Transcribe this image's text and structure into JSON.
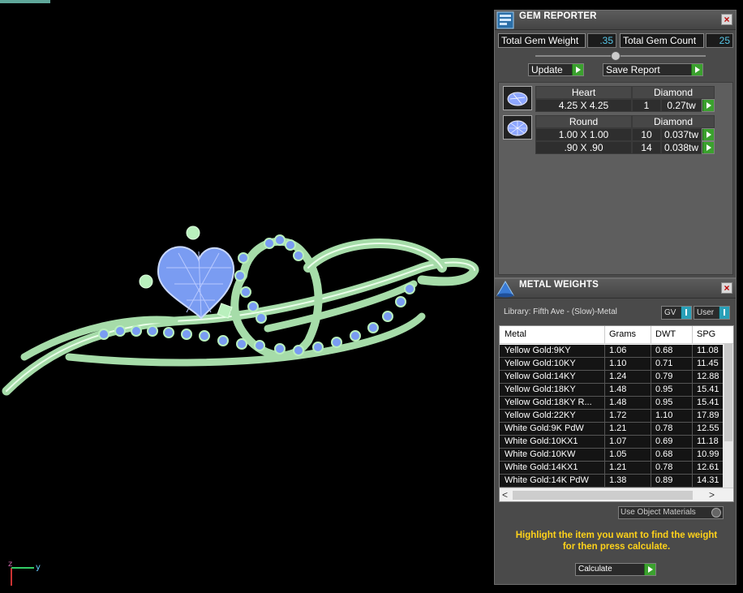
{
  "viewport": {
    "axis": {
      "z": "z",
      "y": "y"
    },
    "colors": {
      "metal": "#b9f0bd",
      "gems": "#7a9cf2",
      "background": "#000000"
    }
  },
  "gem_reporter": {
    "title": "GEM REPORTER",
    "close": "×",
    "total_weight_label": "Total Gem Weight",
    "total_weight_value": ".35",
    "total_count_label": "Total Gem Count",
    "total_count_value": "25",
    "update_label": "Update",
    "save_label": "Save Report",
    "groups": [
      {
        "shape": "Heart",
        "type": "Diamond",
        "rows": [
          {
            "size": "4.25 X 4.25",
            "count": "1",
            "weight": "0.27tw"
          }
        ]
      },
      {
        "shape": "Round",
        "type": "Diamond",
        "rows": [
          {
            "size": "1.00 X 1.00",
            "count": "10",
            "weight": "0.037tw"
          },
          {
            "size": ".90 X .90",
            "count": "14",
            "weight": "0.038tw"
          }
        ]
      }
    ]
  },
  "metal_weights": {
    "title": "METAL WEIGHTS",
    "close": "×",
    "library_label": "Library: Fifth Ave - (Slow)-Metal",
    "gv_label": "GV",
    "user_label": "User",
    "columns": [
      "Metal",
      "Grams",
      "DWT",
      "SPG"
    ],
    "rows": [
      [
        "Yellow Gold:9KY",
        "1.06",
        "0.68",
        "11.08"
      ],
      [
        "Yellow Gold:10KY",
        "1.10",
        "0.71",
        "11.45"
      ],
      [
        "Yellow Gold:14KY",
        "1.24",
        "0.79",
        "12.88"
      ],
      [
        "Yellow Gold:18KY",
        "1.48",
        "0.95",
        "15.41"
      ],
      [
        "Yellow Gold:18KY R...",
        "1.48",
        "0.95",
        "15.41"
      ],
      [
        "Yellow Gold:22KY",
        "1.72",
        "1.10",
        "17.89"
      ],
      [
        "White Gold:9K PdW",
        "1.21",
        "0.78",
        "12.55"
      ],
      [
        "White Gold:10KX1",
        "1.07",
        "0.69",
        "11.18"
      ],
      [
        "White Gold:10KW",
        "1.05",
        "0.68",
        "10.99"
      ],
      [
        "White Gold:14KX1",
        "1.21",
        "0.78",
        "12.61"
      ],
      [
        "White Gold:14K PdW",
        "1.38",
        "0.89",
        "14.31"
      ]
    ],
    "use_object_label": "Use Object Materials",
    "hint_line1": "Highlight the item you want to find the weight",
    "hint_line2": "for then press calculate.",
    "calculate_label": "Calculate",
    "scroll_left": "<",
    "scroll_right": ">"
  }
}
